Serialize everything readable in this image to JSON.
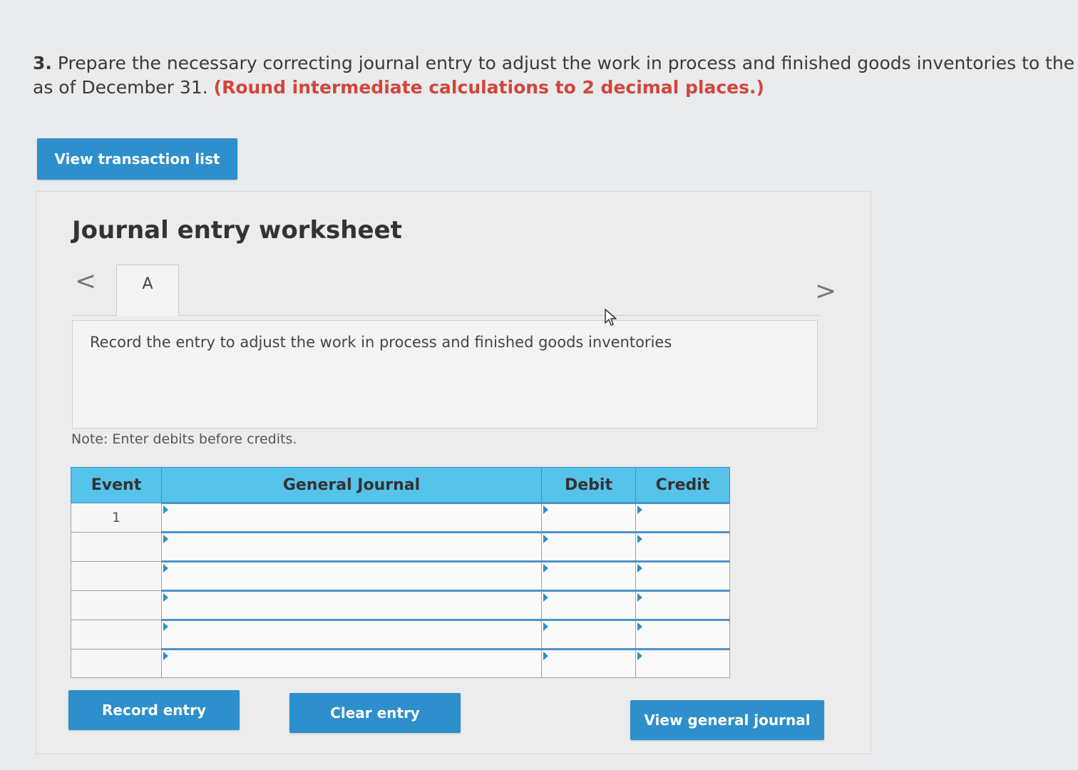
{
  "question": {
    "number": "3.",
    "text": " Prepare the necessary correcting journal entry to adjust the work in process and finished goods inventories to the c",
    "text_line2": "as of December 31. ",
    "instruction": "(Round intermediate calculations to 2 decimal places.)"
  },
  "buttons": {
    "view_transaction_list": "View transaction list",
    "record_entry": "Record entry",
    "clear_entry": "Clear entry",
    "view_general_journal": "View general journal"
  },
  "worksheet": {
    "title": "Journal entry worksheet",
    "prev_arrow": "<",
    "next_arrow": ">",
    "tabs": [
      {
        "label": "A"
      }
    ],
    "instruction": "Record the entry to adjust the work in process and finished goods inventories",
    "note": "Note: Enter debits before credits."
  },
  "journal": {
    "headers": {
      "event": "Event",
      "general_journal": "General Journal",
      "debit": "Debit",
      "credit": "Credit"
    },
    "rows": [
      {
        "event": "1",
        "general_journal": "",
        "debit": "",
        "credit": ""
      },
      {
        "event": "",
        "general_journal": "",
        "debit": "",
        "credit": ""
      },
      {
        "event": "",
        "general_journal": "",
        "debit": "",
        "credit": ""
      },
      {
        "event": "",
        "general_journal": "",
        "debit": "",
        "credit": ""
      },
      {
        "event": "",
        "general_journal": "",
        "debit": "",
        "credit": ""
      },
      {
        "event": "",
        "general_journal": "",
        "debit": "",
        "credit": ""
      }
    ]
  },
  "colors": {
    "button_blue": "#2d8fcb",
    "header_blue": "#55c3ea",
    "instruction_red": "#d0463c"
  }
}
